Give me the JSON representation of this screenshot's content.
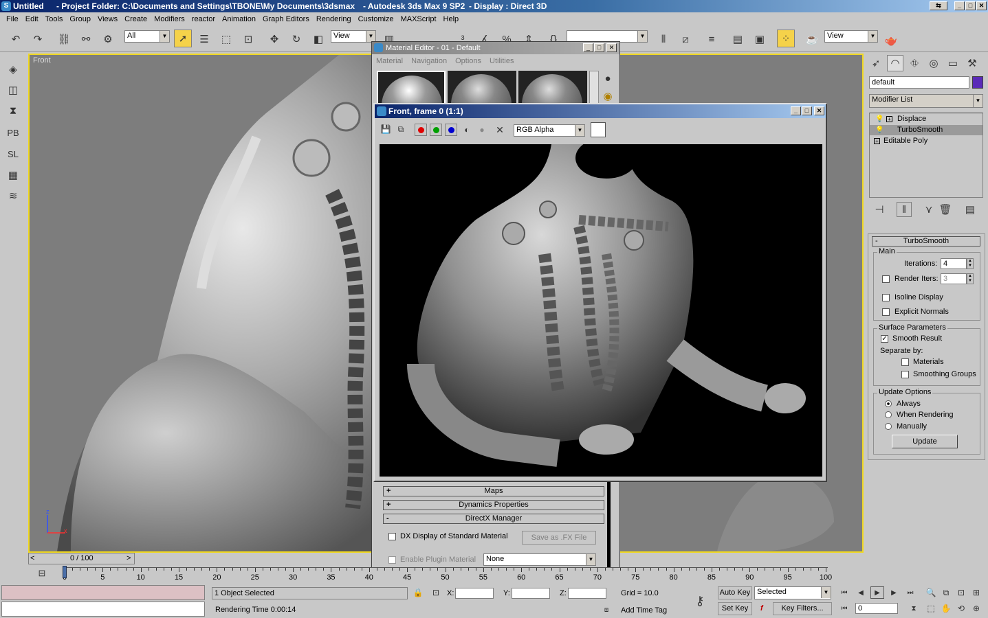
{
  "titlebar": {
    "doc": "Untitled",
    "project": "- Project Folder: C:\\Documents and Settings\\TBONE\\My Documents\\3dsmax",
    "app": "- Autodesk 3ds Max 9 SP2",
    "display": "- Display : Direct 3D"
  },
  "menu": [
    "File",
    "Edit",
    "Tools",
    "Group",
    "Views",
    "Create",
    "Modifiers",
    "reactor",
    "Animation",
    "Graph Editors",
    "Rendering",
    "Customize",
    "MAXScript",
    "Help"
  ],
  "toolbar": {
    "selection_filter": "All",
    "ref_coord": "View",
    "view_right": "View"
  },
  "left_tools": {
    "pb": "PB",
    "sl": "SL"
  },
  "viewport": {
    "label": "Front",
    "axis_z": "z",
    "axis_x": "x"
  },
  "material_editor": {
    "title": "Material Editor - 01 - Default",
    "menu": [
      "Material",
      "Navigation",
      "Options",
      "Utilities"
    ],
    "rollouts": [
      {
        "sign": "+",
        "label": "Maps"
      },
      {
        "sign": "+",
        "label": "Dynamics Properties"
      },
      {
        "sign": "-",
        "label": "DirectX Manager"
      }
    ],
    "dx_display": "DX Display of Standard Material",
    "save_fx": "Save as .FX File",
    "enable_plugin": "Enable Plugin Material",
    "plugin_value": "None"
  },
  "frame_window": {
    "title": "Front, frame 0 (1:1)",
    "channel": "RGB Alpha"
  },
  "command_panel": {
    "object_name": "default",
    "object_color": "#5a2ab8",
    "modifier_list": "Modifier List",
    "stack": [
      {
        "label": "Displace",
        "selected": false
      },
      {
        "label": "TurboSmooth",
        "selected": true
      },
      {
        "label": "Editable Poly",
        "selected": false
      }
    ],
    "turbosmooth": {
      "header": "TurboSmooth",
      "main": "Main",
      "iterations_label": "Iterations:",
      "iterations": "4",
      "render_iters_label": "Render Iters:",
      "render_iters": "3",
      "isoline": "Isoline Display",
      "explicit": "Explicit Normals",
      "surface": "Surface Parameters",
      "smooth_result": "Smooth Result",
      "separate": "Separate by:",
      "materials": "Materials",
      "smoothing": "Smoothing Groups",
      "update_options": "Update Options",
      "always": "Always",
      "when_rendering": "When Rendering",
      "manually": "Manually",
      "update": "Update"
    }
  },
  "timeline": {
    "slider": "0 / 100",
    "ticks": [
      "0",
      "5",
      "10",
      "15",
      "20",
      "25",
      "30",
      "35",
      "40",
      "45",
      "50",
      "55",
      "60",
      "65",
      "70",
      "75",
      "80",
      "85",
      "90",
      "95",
      "100"
    ]
  },
  "status": {
    "selected": "1 Object Selected",
    "render_time": "Rendering Time  0:00:14",
    "x": "X:",
    "y": "Y:",
    "z": "Z:",
    "grid": "Grid = 10.0",
    "add_time_tag": "Add Time Tag",
    "auto_key": "Auto Key",
    "set_key": "Set Key",
    "selected_dd": "Selected",
    "key_filters": "Key Filters...",
    "frame": "0"
  }
}
